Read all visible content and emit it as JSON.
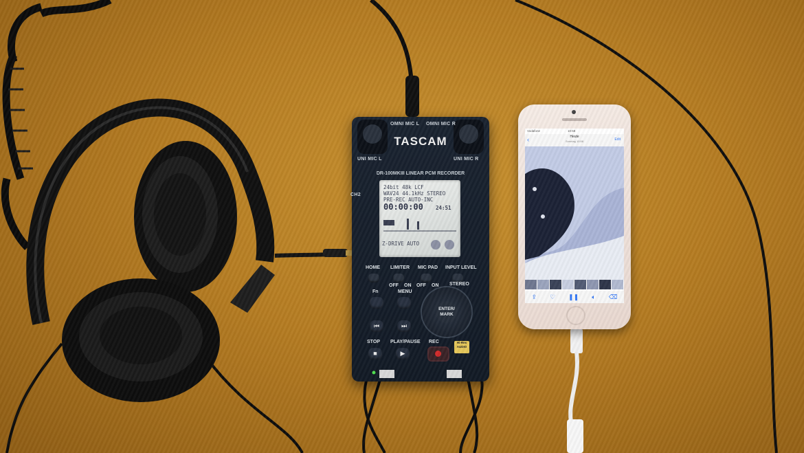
{
  "recorder": {
    "brand": "TASCAM",
    "model": "DR-100MKIII LINEAR PCM RECORDER",
    "omni_mic_l": "OMNI MIC L",
    "omni_mic_r": "OMNI MIC R",
    "uni_mic_l": "UNI MIC L",
    "uni_mic_r": "UNI MIC R",
    "ch": "CH2",
    "lcd": {
      "line1": "24bit 48k LCF",
      "line2": "WAV24 44.1kHz STEREO",
      "line3": "PRE-REC AUTO-INC",
      "time": "00:00:00",
      "remaining": "24:51",
      "bottom": "Z-DRIVE AUTO"
    },
    "labels": {
      "home": "HOME",
      "limiter": "LIMITER",
      "mic_pad": "MIC PAD",
      "input_level": "INPUT LEVEL",
      "off": "OFF",
      "on": "ON",
      "stereo": "STEREO",
      "fn": "Fn",
      "menu": "MENU",
      "stop": "STOP",
      "play_pause": "PLAY/PAUSE",
      "rec": "REC",
      "enter": "ENTER/",
      "mark": "MARK",
      "hires": "Hi-Res AUDIO"
    }
  },
  "phone": {
    "carrier": "Vodafone",
    "clock": "10:58",
    "nav_title": "Heute",
    "nav_subtitle": "Sonntag 10:58",
    "edit": "Edit"
  },
  "colors": {
    "fabric": "#b57c22",
    "recorder_body": "#141c27",
    "phone_body": "#efe0d8",
    "rec_red": "#d02a2a"
  }
}
